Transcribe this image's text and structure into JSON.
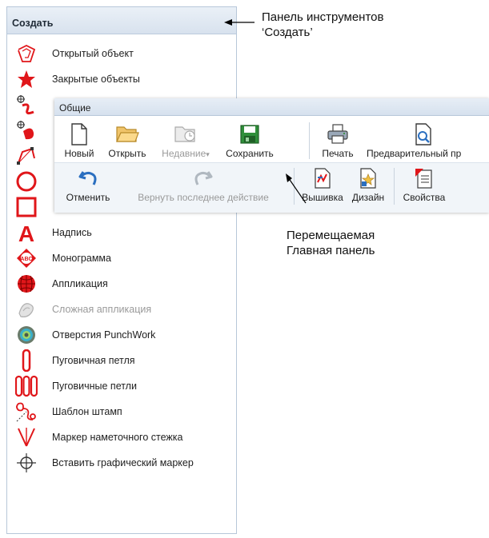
{
  "create_panel": {
    "title": "Создать",
    "items": [
      {
        "label": "Открытый объект",
        "icon": "open-object-icon",
        "disabled": false
      },
      {
        "label": "Закрытые объекты",
        "icon": "closed-object-icon",
        "disabled": false
      },
      {
        "label": "",
        "icon": "column-a-icon",
        "disabled": false
      },
      {
        "label": "",
        "icon": "complex-fill-icon",
        "disabled": false
      },
      {
        "label": "",
        "icon": "outline-shape-icon",
        "disabled": false
      },
      {
        "label": "",
        "icon": "circle-icon",
        "disabled": false
      },
      {
        "label": "",
        "icon": "rectangle-icon",
        "disabled": false
      },
      {
        "label": "Надпись",
        "icon": "lettering-icon",
        "disabled": false
      },
      {
        "label": "Монограмма",
        "icon": "monogram-icon",
        "disabled": false
      },
      {
        "label": "Аппликация",
        "icon": "applique-icon",
        "disabled": false
      },
      {
        "label": "Сложная аппликация",
        "icon": "complex-applique-icon",
        "disabled": true
      },
      {
        "label": "Отверстия PunchWork",
        "icon": "punchwork-icon",
        "disabled": false
      },
      {
        "label": "Пуговичная петля",
        "icon": "buttonhole-icon",
        "disabled": false
      },
      {
        "label": "Пуговичные петли",
        "icon": "buttonholes-icon",
        "disabled": false
      },
      {
        "label": "Шаблон штамп",
        "icon": "stamp-template-icon",
        "disabled": false
      },
      {
        "label": "Маркер наметочного стежка",
        "icon": "basting-marker-icon",
        "disabled": false
      },
      {
        "label": "Вставить графический маркер",
        "icon": "graphic-marker-icon",
        "disabled": false
      }
    ]
  },
  "general_toolbar": {
    "title": "Общие",
    "row1": [
      {
        "label": "Новый",
        "icon": "new-document-icon",
        "disabled": false
      },
      {
        "label": "Открыть",
        "icon": "folder-open-icon",
        "disabled": false
      },
      {
        "label": "Недавние",
        "icon": "recent-files-icon",
        "disabled": true,
        "dropdown": "▾"
      },
      {
        "label": "Сохранить",
        "icon": "save-icon",
        "disabled": false
      },
      {
        "label": "Печать",
        "icon": "print-icon",
        "disabled": false
      },
      {
        "label": "Предварительный пр",
        "icon": "print-preview-icon",
        "disabled": false
      }
    ],
    "row2": [
      {
        "label": "Отменить",
        "icon": "undo-icon",
        "disabled": false
      },
      {
        "label": "Вернуть последнее действие",
        "icon": "redo-icon",
        "disabled": true
      },
      {
        "label": "Вышивка",
        "icon": "embroidery-icon",
        "disabled": false
      },
      {
        "label": "Дизайн",
        "icon": "design-icon",
        "disabled": false
      },
      {
        "label": "Свойства",
        "icon": "properties-icon",
        "disabled": false
      }
    ]
  },
  "callouts": {
    "create_panel_line1": "Панель инструментов",
    "create_panel_line2": "‘Создать’",
    "general_line1": "Перемещаемая",
    "general_line2": "Главная панель"
  },
  "colors": {
    "accent_red": "#e0161a",
    "panel_border": "#b7c7d9",
    "disabled_text": "#9a9a9a",
    "undo_blue": "#2b6fc0"
  }
}
